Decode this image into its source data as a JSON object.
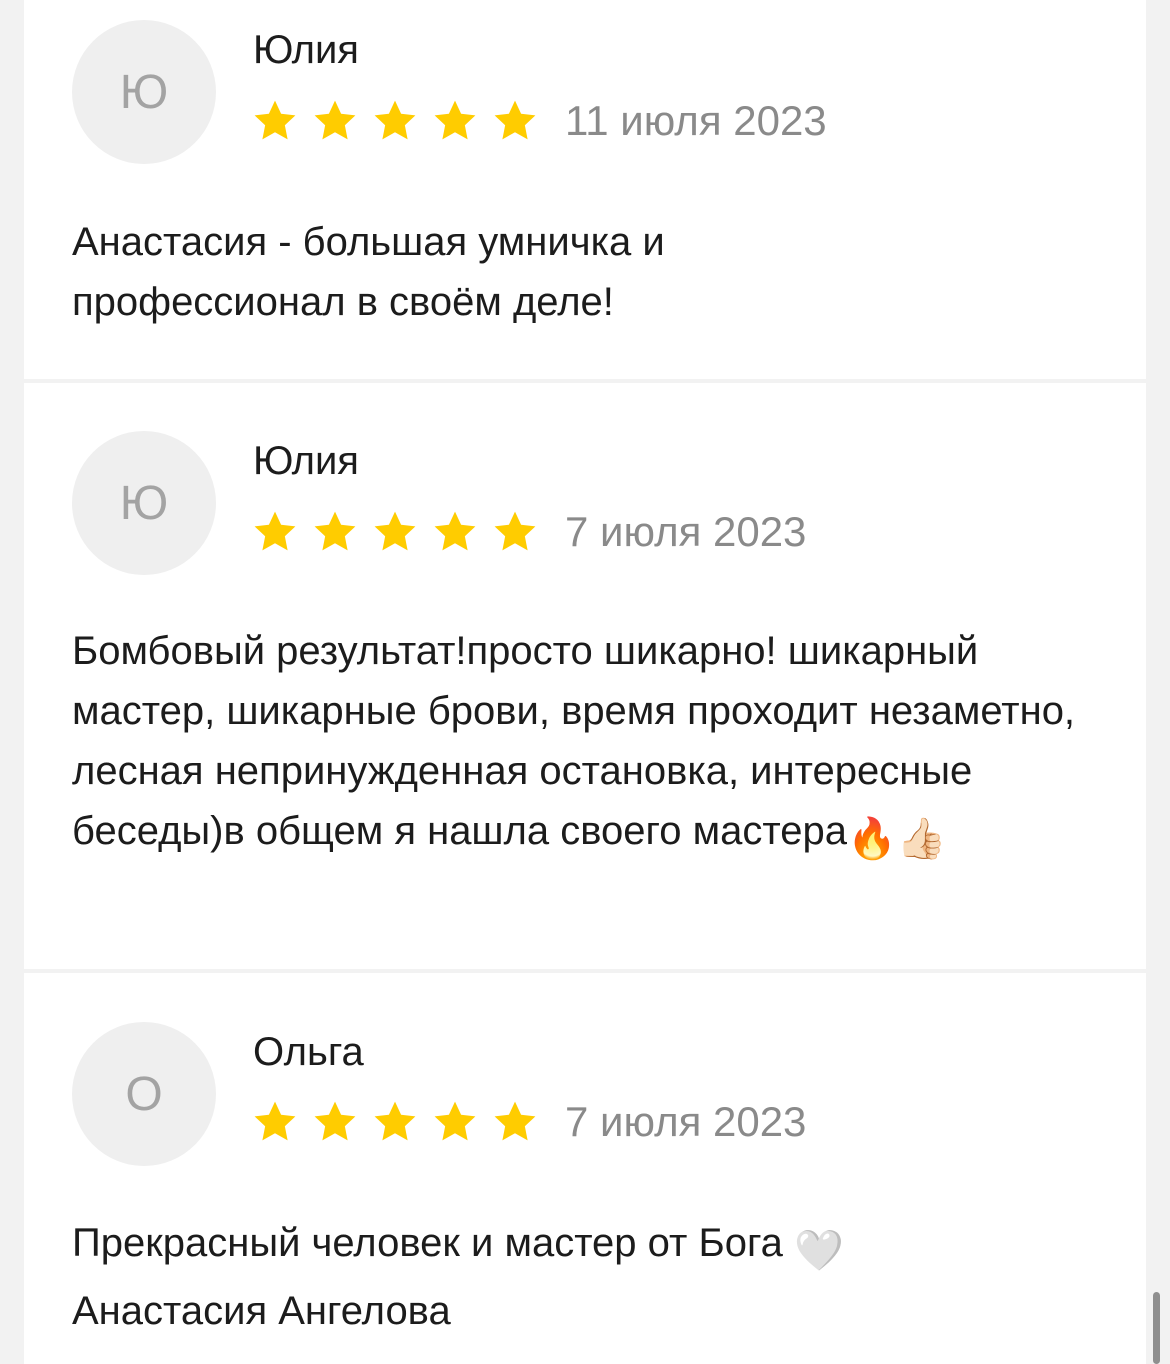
{
  "colors": {
    "star": "#FFCC00",
    "avatar_bg": "#EFEFEF",
    "date": "#8A8A8A",
    "separator": "#F2F2F2"
  },
  "reviews": [
    {
      "initial": "Ю",
      "author": "Юлия",
      "rating": 5,
      "date": "11 июля 2023",
      "text": "Анастасия - большая умничка и профессионал в своём деле!"
    },
    {
      "initial": "Ю",
      "author": "Юлия",
      "rating": 5,
      "date": "7 июля 2023",
      "text": "Бомбовый результат!просто шикарно! шикарный мастер, шикарные брови, время проходит незаметно, лесная непринужденная остановка, интересные беседы)в общем я нашла своего мастера",
      "emojis": [
        "🔥",
        "👍🏻"
      ]
    },
    {
      "initial": "О",
      "author": "Ольга",
      "rating": 5,
      "date": "7 июля 2023",
      "text_line1": "Прекрасный человек и мастер от Бога",
      "emoji": "🤍",
      "text_line2": "Анастасия Ангелова"
    }
  ]
}
